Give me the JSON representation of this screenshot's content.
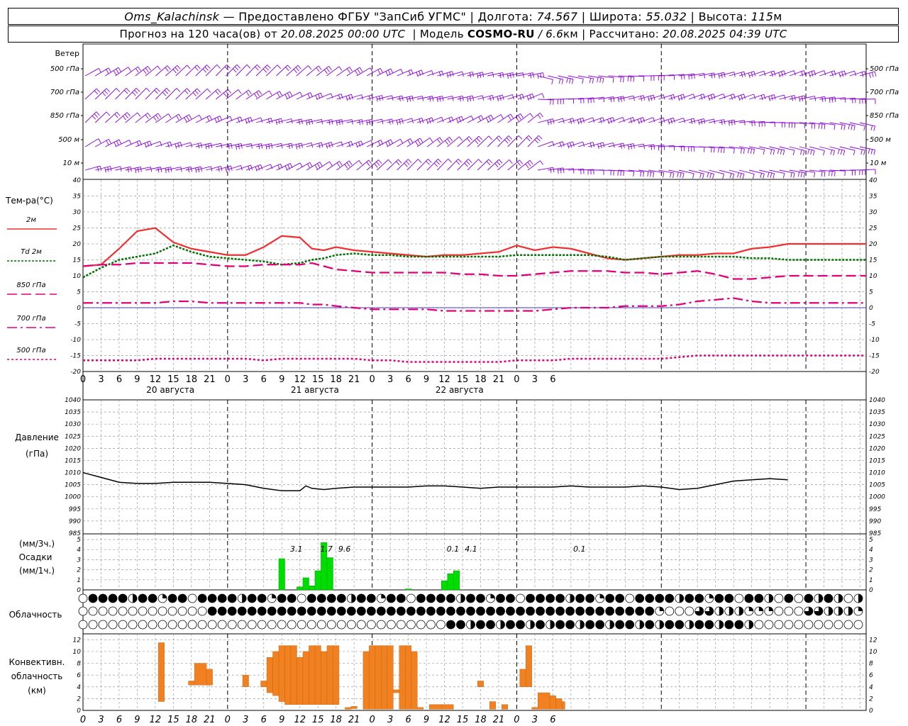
{
  "header": {
    "station": "Oms_Kalachinsk",
    "provider": " — Предоставлено ФГБУ \"ЗапСиб УГМС\" | Долгота: ",
    "lon": "74.567",
    "lat_label": " | Широта: ",
    "lat": "55.032",
    "alt_label": " | Высота: ",
    "alt": "115",
    "alt_unit": "м",
    "forecast_prefix": "Прогноз на 120 часа(ов) от ",
    "run_time": "20.08.2025 00:00 UTC",
    "model_label": "  | Модель ",
    "model": "COSMO-RU",
    "resolution": " / 6.6",
    "res_unit": "км",
    "calc_label": " | Рассчитано: ",
    "calc_time": "20.08.2025 04:39 UTC"
  },
  "colors": {
    "wind": "#8800dd",
    "t2m": "#f03030",
    "td2m": "#007000",
    "t850": "#e0007a",
    "t700": "#e0007a",
    "t500": "#e0007a",
    "pressure": "#000000",
    "precip": "#00dd00",
    "convective": "#f08020",
    "grid": "#9a9a9a",
    "zero_line": "#0000cc"
  },
  "wind_panel": {
    "title": "Ветер",
    "levels": [
      "500 гПа",
      "700 гПа",
      "850 гПа",
      "500 м",
      "10  м"
    ]
  },
  "temp_panel": {
    "title": "Тем-ра(°С)",
    "legend": [
      {
        "label": "2м",
        "key": "t2m"
      },
      {
        "label": "Td  2м",
        "key": "td2m"
      },
      {
        "label": "850 гПа",
        "key": "t850"
      },
      {
        "label": "700 гПа",
        "key": "t700"
      },
      {
        "label": "500 гПа",
        "key": "t500"
      }
    ]
  },
  "pressure_panel": {
    "title": "Давление",
    "unit": "(гПа)"
  },
  "precip_panel": {
    "unit3": "(мм/3ч.)",
    "title": "Осадки",
    "unit1": "(мм/1ч.)"
  },
  "cloud_panel": {
    "title": "Облачность"
  },
  "conv_panel": {
    "title1": "Конвективн.",
    "title2": "облачность",
    "unit": "(км)"
  },
  "chart_data": [
    {
      "type": "line",
      "name": "temperature",
      "x_hours": [
        0,
        3,
        6,
        9,
        12,
        15,
        18,
        21,
        24,
        27,
        30,
        33,
        36,
        38,
        40,
        42,
        45,
        48,
        51,
        54,
        57,
        60,
        63,
        66,
        69,
        72,
        75,
        78,
        81,
        84,
        87,
        90,
        93,
        96,
        99,
        102,
        105,
        108,
        111,
        114,
        117,
        120,
        123,
        126,
        129,
        130
      ],
      "series": [
        {
          "key": "t2m",
          "values": [
            13.0,
            13.5,
            18.5,
            24,
            25,
            20.5,
            18.5,
            17.5,
            16.5,
            16.5,
            19,
            22.5,
            22,
            18.5,
            18,
            19,
            18,
            17.5,
            17,
            16.5,
            16,
            16.5,
            16.5,
            17,
            17.5,
            19.5,
            18,
            19,
            18.5,
            17,
            15.5,
            15,
            15.5,
            16,
            16.5,
            16.5,
            17,
            17,
            18.5,
            19,
            20,
            20,
            20,
            20,
            20,
            20
          ]
        },
        {
          "key": "td2m",
          "values": [
            9.5,
            12.5,
            15,
            16,
            17,
            19.5,
            17.5,
            16,
            15.5,
            15,
            14.5,
            13.5,
            14,
            15,
            15.5,
            16.5,
            17,
            16.5,
            16.5,
            16,
            16,
            16,
            16,
            16,
            16,
            16.5,
            16.5,
            16.5,
            16.5,
            16.5,
            16,
            15,
            15.5,
            16,
            16,
            16,
            16,
            16,
            15.5,
            15.5,
            15,
            15,
            15,
            15,
            15,
            15
          ]
        },
        {
          "key": "t850",
          "values": [
            13,
            13.5,
            13.5,
            14,
            14,
            14,
            14,
            13.5,
            13,
            13,
            13.5,
            13.5,
            13.5,
            14,
            13,
            12,
            11.5,
            11,
            11,
            11,
            11,
            11,
            10.5,
            10.5,
            10,
            10,
            10.5,
            11,
            11.5,
            11.5,
            11.5,
            11,
            11,
            10.5,
            11,
            11.5,
            10.5,
            9,
            9,
            9.5,
            10,
            10,
            10,
            10,
            10,
            10
          ]
        },
        {
          "key": "t700",
          "values": [
            1.5,
            1.5,
            1.5,
            1.5,
            1.5,
            2,
            2,
            1.5,
            1.5,
            1.5,
            1.5,
            1.5,
            1.5,
            1,
            1,
            0.5,
            0,
            -0.5,
            -0.5,
            -0.5,
            -0.5,
            -1,
            -1,
            -1,
            -1,
            -1,
            -1,
            -0.5,
            0,
            0,
            0,
            0.5,
            0.5,
            0.5,
            1,
            2,
            2.5,
            3,
            2,
            1.5,
            1.5,
            1.5,
            1.5,
            1.5,
            1.5,
            1.5
          ]
        },
        {
          "key": "t500",
          "values": [
            -16.5,
            -16.5,
            -16.5,
            -16.5,
            -16,
            -16,
            -16,
            -16,
            -16,
            -16,
            -16.5,
            -16,
            -16,
            -16,
            -16,
            -16,
            -16,
            -16.5,
            -16.5,
            -17,
            -17,
            -17,
            -17,
            -17,
            -17,
            -16.5,
            -16.5,
            -16.5,
            -16,
            -16,
            -16,
            -16,
            -16,
            -16,
            -15.5,
            -15,
            -15,
            -15,
            -15,
            -15,
            -15,
            -15,
            -15,
            -15,
            -15,
            -15
          ]
        }
      ],
      "ylim": [
        -20,
        40
      ]
    },
    {
      "type": "line",
      "name": "pressure",
      "x_hours": [
        0,
        3,
        6,
        9,
        12,
        15,
        18,
        21,
        24,
        27,
        30,
        33,
        36,
        37,
        38,
        40,
        42,
        45,
        48,
        51,
        54,
        57,
        60,
        63,
        66,
        69,
        72,
        75,
        78,
        81,
        84,
        87,
        90,
        93,
        96,
        99,
        102,
        105,
        108,
        111,
        114,
        117
      ],
      "values": [
        1010,
        1008,
        1006,
        1005.5,
        1005.5,
        1006,
        1006,
        1006,
        1005.5,
        1005,
        1003.5,
        1002.5,
        1002.5,
        1004.5,
        1003.5,
        1003,
        1003.5,
        1004,
        1004,
        1004,
        1004,
        1004.5,
        1004.5,
        1004,
        1003.5,
        1004,
        1004,
        1004,
        1004,
        1004.5,
        1004,
        1004,
        1004,
        1004.5,
        1004,
        1003,
        1003.5,
        1005,
        1006.5,
        1007,
        1007.5,
        1007
      ],
      "ylim": [
        985,
        1040
      ]
    },
    {
      "type": "bar",
      "name": "precipitation",
      "x_hours": [
        33,
        36,
        37,
        38,
        39,
        40,
        41,
        42,
        54,
        60,
        61,
        62
      ],
      "values_mm": [
        3.1,
        0.3,
        1.2,
        0.4,
        1.9,
        4.7,
        3.2,
        0,
        0.1,
        0.9,
        1.6,
        1.9
      ],
      "labels": [
        {
          "x": 34,
          "text": "3.1"
        },
        {
          "x": 39,
          "text": "1.7"
        },
        {
          "x": 42,
          "text": "9.6"
        },
        {
          "x": 60,
          "text": "0.1"
        },
        {
          "x": 63,
          "text": "4.1"
        },
        {
          "x": 81,
          "text": "0.1"
        }
      ],
      "ylim": [
        0,
        5
      ]
    },
    {
      "type": "bar",
      "name": "convective_clouds",
      "bars": [
        {
          "x0": 12.5,
          "x1": 13.5,
          "base": 1.5,
          "top": 11.5
        },
        {
          "x0": 17.5,
          "x1": 18.5,
          "base": 4.3,
          "top": 5
        },
        {
          "x0": 18.5,
          "x1": 20.5,
          "base": 4.3,
          "top": 8
        },
        {
          "x0": 20.5,
          "x1": 21.5,
          "base": 4.3,
          "top": 7
        },
        {
          "x0": 26.5,
          "x1": 27.5,
          "base": 4,
          "top": 6
        },
        {
          "x0": 29.5,
          "x1": 30.5,
          "base": 4,
          "top": 5
        },
        {
          "x0": 30.5,
          "x1": 31.5,
          "base": 3,
          "top": 9
        },
        {
          "x0": 31.5,
          "x1": 32.5,
          "base": 2.5,
          "top": 10
        },
        {
          "x0": 32.5,
          "x1": 33.5,
          "base": 1.5,
          "top": 11
        },
        {
          "x0": 33.5,
          "x1": 34.5,
          "base": 1,
          "top": 11
        },
        {
          "x0": 34.5,
          "x1": 35.5,
          "base": 1,
          "top": 11
        },
        {
          "x0": 35.5,
          "x1": 36.5,
          "base": 1,
          "top": 9
        },
        {
          "x0": 36.5,
          "x1": 37.5,
          "base": 1,
          "top": 10
        },
        {
          "x0": 37.5,
          "x1": 38.5,
          "base": 1,
          "top": 11
        },
        {
          "x0": 38.5,
          "x1": 39.5,
          "base": 1,
          "top": 11
        },
        {
          "x0": 39.5,
          "x1": 40.5,
          "base": 1,
          "top": 10
        },
        {
          "x0": 40.5,
          "x1": 41.5,
          "base": 1,
          "top": 11
        },
        {
          "x0": 41.5,
          "x1": 42.5,
          "base": 1,
          "top": 11
        },
        {
          "x0": 43.5,
          "x1": 44.5,
          "base": 0.2,
          "top": 0.5
        },
        {
          "x0": 44.5,
          "x1": 45.5,
          "base": 0.3,
          "top": 0.7
        },
        {
          "x0": 46.5,
          "x1": 47.5,
          "base": 0.2,
          "top": 10
        },
        {
          "x0": 47.5,
          "x1": 48.5,
          "base": 0.2,
          "top": 11
        },
        {
          "x0": 48.5,
          "x1": 49.5,
          "base": 0.2,
          "top": 11
        },
        {
          "x0": 49.5,
          "x1": 50.5,
          "base": 0.2,
          "top": 11
        },
        {
          "x0": 50.5,
          "x1": 51.5,
          "base": 0.2,
          "top": 11
        },
        {
          "x0": 51.5,
          "x1": 52.5,
          "base": 3,
          "top": 3.5
        },
        {
          "x0": 52.5,
          "x1": 53.5,
          "base": 0.2,
          "top": 11
        },
        {
          "x0": 53.5,
          "x1": 54.5,
          "base": 0.2,
          "top": 11
        },
        {
          "x0": 54.5,
          "x1": 55.5,
          "base": 0.2,
          "top": 10
        },
        {
          "x0": 55.5,
          "x1": 56.5,
          "base": 0.2,
          "top": 0.5
        },
        {
          "x0": 57.5,
          "x1": 59.5,
          "base": 0.2,
          "top": 1
        },
        {
          "x0": 59.5,
          "x1": 61.5,
          "base": 0.2,
          "top": 1
        },
        {
          "x0": 65.5,
          "x1": 66.5,
          "base": 4,
          "top": 5
        },
        {
          "x0": 67.5,
          "x1": 68.5,
          "base": 0.2,
          "top": 1.5
        },
        {
          "x0": 69.5,
          "x1": 70.5,
          "base": 0.2,
          "top": 1
        },
        {
          "x0": 72.5,
          "x1": 73.5,
          "base": 4,
          "top": 7
        },
        {
          "x0": 73.5,
          "x1": 74.5,
          "base": 4,
          "top": 11
        },
        {
          "x0": 74.5,
          "x1": 75.5,
          "base": 0.2,
          "top": 0.5
        },
        {
          "x0": 75.5,
          "x1": 77.5,
          "base": 0.2,
          "top": 3
        },
        {
          "x0": 77.5,
          "x1": 78.5,
          "base": 0.2,
          "top": 2.5
        },
        {
          "x0": 78.5,
          "x1": 79.5,
          "base": 0.2,
          "top": 2
        },
        {
          "x0": 79.5,
          "x1": 80,
          "base": 0.2,
          "top": 1.5
        }
      ],
      "ylim": [
        0,
        13
      ]
    }
  ],
  "x_axis": {
    "hours": [
      "0",
      "3",
      "6",
      "9",
      "12",
      "15",
      "18",
      "21",
      "0",
      "3",
      "6",
      "9",
      "12",
      "15",
      "18",
      "21",
      "0",
      "3",
      "6",
      "9",
      "12",
      "15",
      "18",
      "21",
      "0",
      "3",
      "6"
    ],
    "days": [
      {
        "label": "20 августа",
        "hour": 10.5
      },
      {
        "label": "21 августа",
        "hour": 34.5
      },
      {
        "label": "22 августа",
        "hour": 58.5
      }
    ]
  }
}
